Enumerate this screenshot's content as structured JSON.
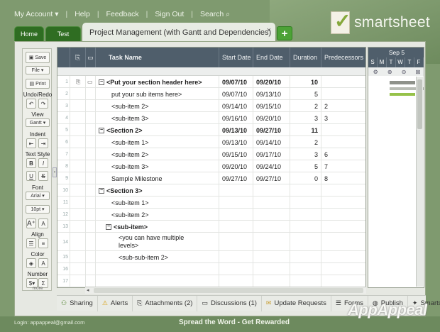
{
  "nav": {
    "my_account": "My Account ▾",
    "help": "Help",
    "feedback": "Feedback",
    "sign_out": "Sign Out",
    "search": "Search"
  },
  "logo": {
    "text": "smartsheet"
  },
  "tabs": {
    "home": "Home",
    "test": "Test",
    "active": "Project Management (with Gantt and Dependencies)",
    "close": "×",
    "add": "+"
  },
  "sidebar": {
    "save": "Save",
    "file": "File ▾",
    "print": "Print",
    "undo_redo": "Undo/Redo",
    "view": "View",
    "gantt": "Gantt ▾",
    "indent": "Indent",
    "text_style": "Text Style",
    "bold": "B",
    "italic": "I",
    "underline": "U",
    "strike": "S",
    "font": "Font",
    "font_name": "Arial ▾",
    "font_size": "10pt ▾",
    "align": "Align",
    "color": "Color",
    "number": "Number",
    "currency": "$▾",
    "more": "more"
  },
  "grid": {
    "headers": {
      "task": "Task Name",
      "start": "Start Date",
      "end": "End Date",
      "duration": "Duration",
      "pred": "Predecessors"
    },
    "rows": [
      {
        "n": "1",
        "task": "<Put your section header here>",
        "start": "09/07/10",
        "end": "09/20/10",
        "dur": "10",
        "pred": "",
        "bold": true,
        "level": 0,
        "collapse": true
      },
      {
        "n": "2",
        "task": "put your sub items here>",
        "start": "09/07/10",
        "end": "09/13/10",
        "dur": "5",
        "pred": "",
        "bold": false,
        "level": 1
      },
      {
        "n": "3",
        "task": "<sub-item 2>",
        "start": "09/14/10",
        "end": "09/15/10",
        "dur": "2",
        "pred": "2",
        "bold": false,
        "level": 1
      },
      {
        "n": "4",
        "task": "<sub-item 3>",
        "start": "09/16/10",
        "end": "09/20/10",
        "dur": "3",
        "pred": "3",
        "bold": false,
        "level": 1
      },
      {
        "n": "5",
        "task": "<Section 2>",
        "start": "09/13/10",
        "end": "09/27/10",
        "dur": "11",
        "pred": "",
        "bold": true,
        "level": 0,
        "collapse": true
      },
      {
        "n": "6",
        "task": "<sub-item 1>",
        "start": "09/13/10",
        "end": "09/14/10",
        "dur": "2",
        "pred": "",
        "bold": false,
        "level": 1
      },
      {
        "n": "7",
        "task": "<sub-item 2>",
        "start": "09/15/10",
        "end": "09/17/10",
        "dur": "3",
        "pred": "6",
        "bold": false,
        "level": 1
      },
      {
        "n": "8",
        "task": "<sub-item 3>",
        "start": "09/20/10",
        "end": "09/24/10",
        "dur": "5",
        "pred": "7",
        "bold": false,
        "level": 1
      },
      {
        "n": "9",
        "task": "Sample Milestone",
        "start": "09/27/10",
        "end": "09/27/10",
        "dur": "0",
        "pred": "8",
        "bold": false,
        "level": 1
      },
      {
        "n": "10",
        "task": "<Section 3>",
        "start": "",
        "end": "",
        "dur": "",
        "pred": "",
        "bold": true,
        "level": 0,
        "collapse": true
      },
      {
        "n": "11",
        "task": "<sub-item 1>",
        "start": "",
        "end": "",
        "dur": "",
        "pred": "",
        "bold": false,
        "level": 1
      },
      {
        "n": "12",
        "task": "<sub-item 2>",
        "start": "",
        "end": "",
        "dur": "",
        "pred": "",
        "bold": false,
        "level": 1
      },
      {
        "n": "13",
        "task": "<sub-item>",
        "start": "",
        "end": "",
        "dur": "",
        "pred": "",
        "bold": true,
        "level": 1,
        "collapse": true
      },
      {
        "n": "14",
        "task": "<you can have multiple levels>",
        "start": "",
        "end": "",
        "dur": "",
        "pred": "",
        "bold": false,
        "level": 2,
        "tall": true
      },
      {
        "n": "15",
        "task": "<sub-sub-item 2>",
        "start": "",
        "end": "",
        "dur": "",
        "pred": "",
        "bold": false,
        "level": 2
      },
      {
        "n": "16",
        "task": "",
        "start": "",
        "end": "",
        "dur": "",
        "pred": "",
        "bold": false,
        "level": 0
      },
      {
        "n": "17",
        "task": "",
        "start": "",
        "end": "",
        "dur": "",
        "pred": "",
        "bold": false,
        "level": 0
      }
    ]
  },
  "gantt": {
    "week": "Sep 5",
    "days": [
      "S",
      "M",
      "T",
      "W",
      "T",
      "F"
    ]
  },
  "bottom": {
    "sharing": "Sharing",
    "alerts": "Alerts",
    "attachments": "Attachments (2)",
    "discussions": "Discussions (1)",
    "update_requests": "Update Requests",
    "forms": "Forms",
    "publish": "Publish",
    "smartsource": "Smartsou"
  },
  "footer": {
    "login": "Login: appappeal@gmail.com",
    "spread": "Spread the Word - Get Rewarded"
  },
  "watermark": "AppAppeal",
  "colors": {
    "background": "#7f9a6f",
    "tab_green": "#2f6d22",
    "header": "#4f5e6b"
  }
}
